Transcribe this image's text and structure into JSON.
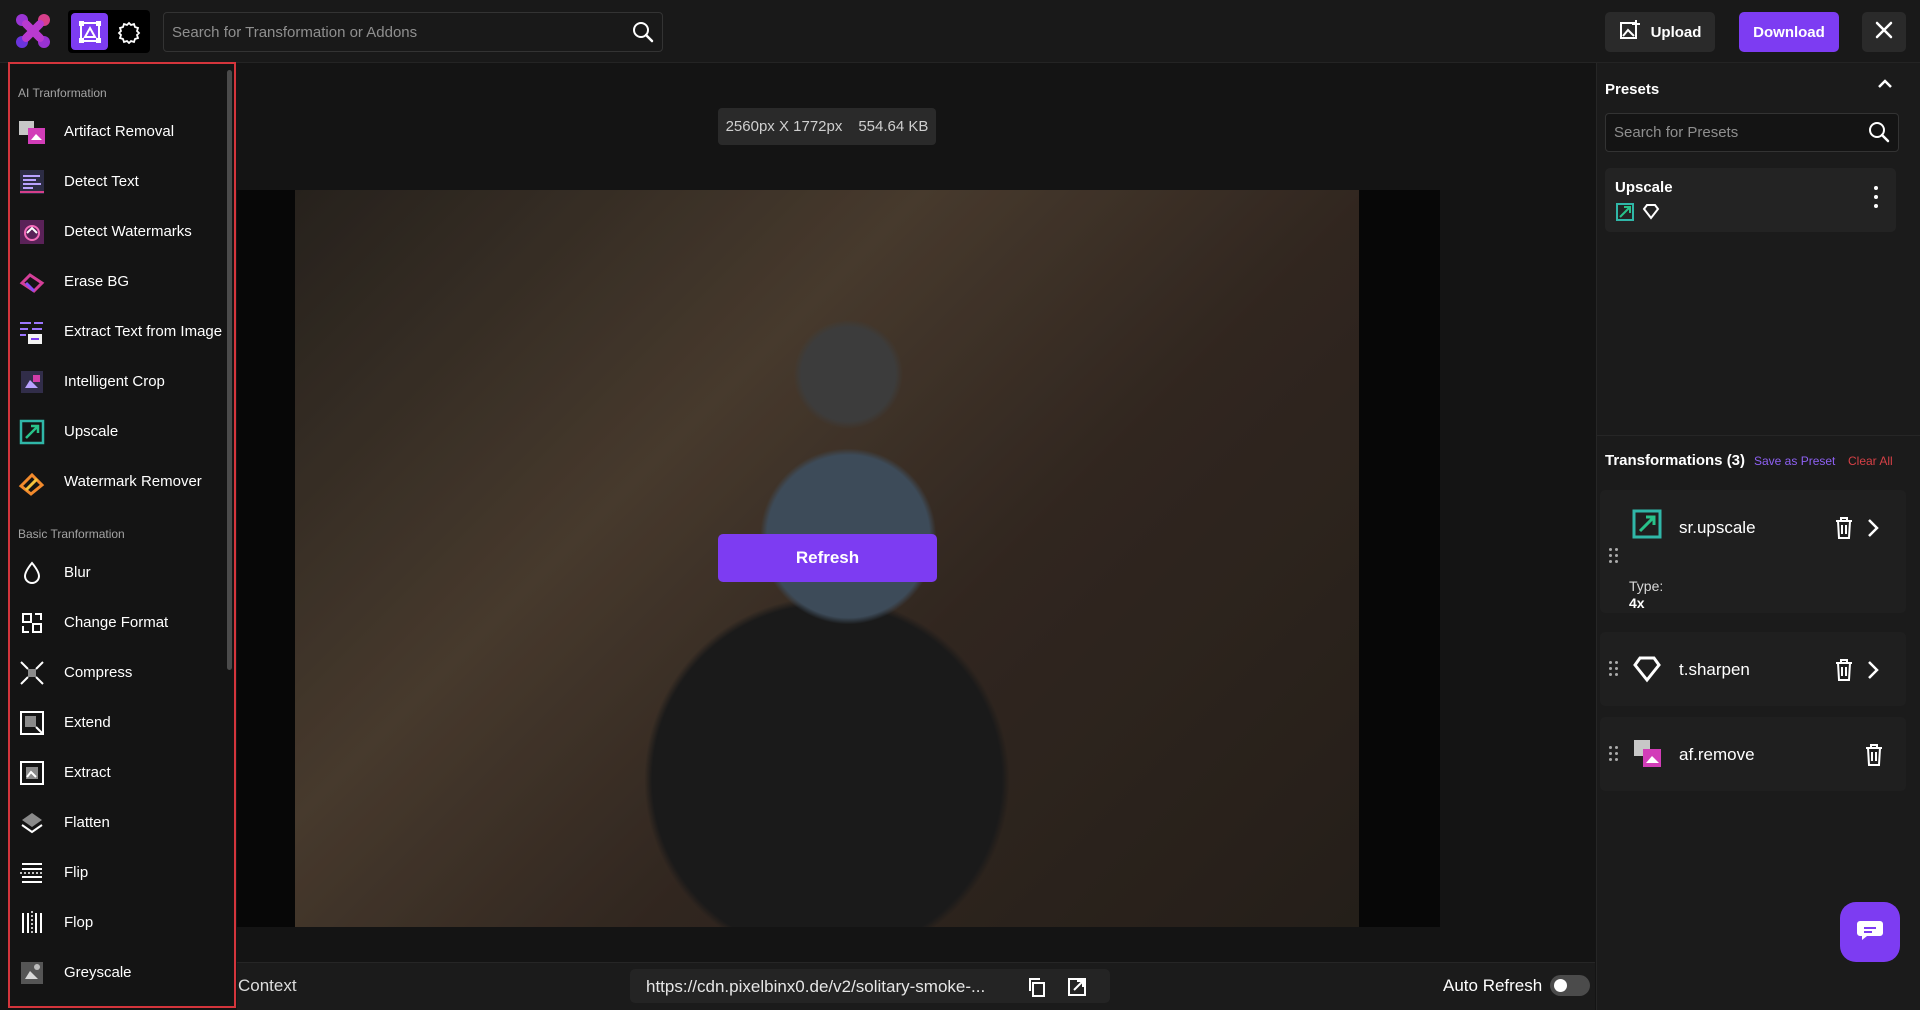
{
  "header": {
    "search_placeholder": "Search for Transformation or Addons",
    "upload_label": "Upload",
    "download_label": "Download",
    "icons": {
      "logo": "pixelbin-logo-icon",
      "transform_mode": "transform-mode-icon",
      "addon_mode": "gear-icon",
      "search": "search-icon",
      "upload": "image-upload-icon",
      "close": "close-icon"
    }
  },
  "sidebar": {
    "sections": [
      {
        "label": "AI Tranformation",
        "items": [
          {
            "label": "Artifact Removal",
            "icon": "artifact-removal-icon"
          },
          {
            "label": "Detect Text",
            "icon": "detect-text-icon"
          },
          {
            "label": "Detect Watermarks",
            "icon": "detect-watermarks-icon"
          },
          {
            "label": "Erase BG",
            "icon": "erase-bg-icon"
          },
          {
            "label": "Extract Text from Image",
            "icon": "extract-text-icon"
          },
          {
            "label": "Intelligent Crop",
            "icon": "intelligent-crop-icon"
          },
          {
            "label": "Upscale",
            "icon": "upscale-icon"
          },
          {
            "label": "Watermark Remover",
            "icon": "watermark-remover-icon"
          }
        ]
      },
      {
        "label": "Basic Tranformation",
        "items": [
          {
            "label": "Blur",
            "icon": "blur-icon"
          },
          {
            "label": "Change Format",
            "icon": "change-format-icon"
          },
          {
            "label": "Compress",
            "icon": "compress-icon"
          },
          {
            "label": "Extend",
            "icon": "extend-icon"
          },
          {
            "label": "Extract",
            "icon": "extract-icon"
          },
          {
            "label": "Flatten",
            "icon": "flatten-icon"
          },
          {
            "label": "Flip",
            "icon": "flip-icon"
          },
          {
            "label": "Flop",
            "icon": "flop-icon"
          },
          {
            "label": "Greyscale",
            "icon": "greyscale-icon"
          }
        ]
      }
    ]
  },
  "canvas": {
    "dimensions": "2560px X 1772px",
    "filesize": "554.64 KB",
    "refresh_label": "Refresh",
    "context_label": "Context",
    "url": "https://cdn.pixelbinx0.de/v2/solitary-smoke-...",
    "auto_refresh_label": "Auto Refresh",
    "auto_refresh_on": false
  },
  "right_panel": {
    "presets_title": "Presets",
    "preset_search_placeholder": "Search for Presets",
    "preset_items": [
      {
        "name": "Upscale",
        "icons": [
          "upscale-icon",
          "sharpen-icon"
        ]
      }
    ],
    "transformations_title": "Transformations (3)",
    "save_preset_label": "Save as Preset",
    "clear_all_label": "Clear All",
    "transformations": [
      {
        "name": "sr.upscale",
        "icon": "upscale-icon",
        "type_label": "Type:",
        "type_value": "4x"
      },
      {
        "name": "t.sharpen",
        "icon": "sharpen-icon"
      },
      {
        "name": "af.remove",
        "icon": "artifact-removal-icon"
      }
    ]
  },
  "colors": {
    "accent": "#7d3cf2",
    "danger": "#d64046",
    "selection_outline": "#d4353c",
    "background": "#141414"
  }
}
